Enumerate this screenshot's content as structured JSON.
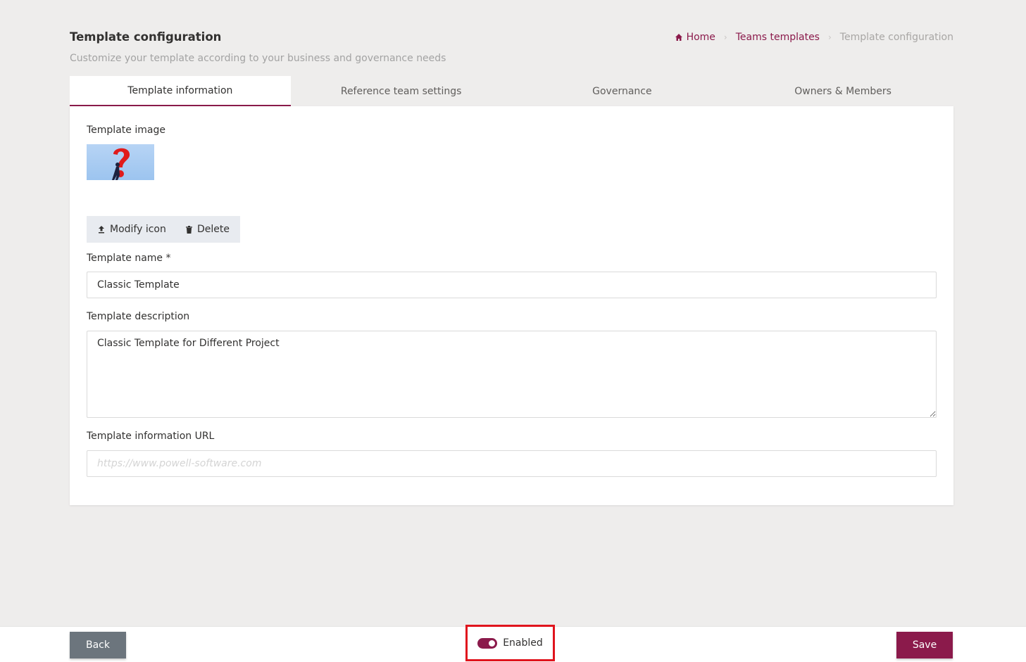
{
  "header": {
    "title": "Template configuration",
    "subtitle": "Customize your template according to your business and governance needs"
  },
  "breadcrumb": {
    "items": [
      {
        "label": "Home",
        "icon": "home-icon"
      },
      {
        "label": "Teams templates"
      },
      {
        "label": "Template configuration"
      }
    ]
  },
  "tabs": [
    {
      "label": "Template information",
      "active": true
    },
    {
      "label": "Reference team settings",
      "active": false
    },
    {
      "label": "Governance",
      "active": false
    },
    {
      "label": "Owners & Members",
      "active": false
    }
  ],
  "form": {
    "image_label": "Template image",
    "modify_icon_label": "Modify icon",
    "delete_label": "Delete",
    "name_label": "Template name *",
    "name_value": "Classic Template",
    "description_label": "Template description",
    "description_value": "Classic Template for Different Project",
    "url_label": "Template information URL",
    "url_value": "",
    "url_placeholder": "https://www.powell-software.com"
  },
  "footer": {
    "back_label": "Back",
    "toggle_label": "Enabled",
    "toggle_on": true,
    "save_label": "Save"
  },
  "colors": {
    "accent": "#8b1a4b",
    "back_button": "#6c757d",
    "highlight_box": "#e0141d",
    "background": "#eeedec"
  }
}
